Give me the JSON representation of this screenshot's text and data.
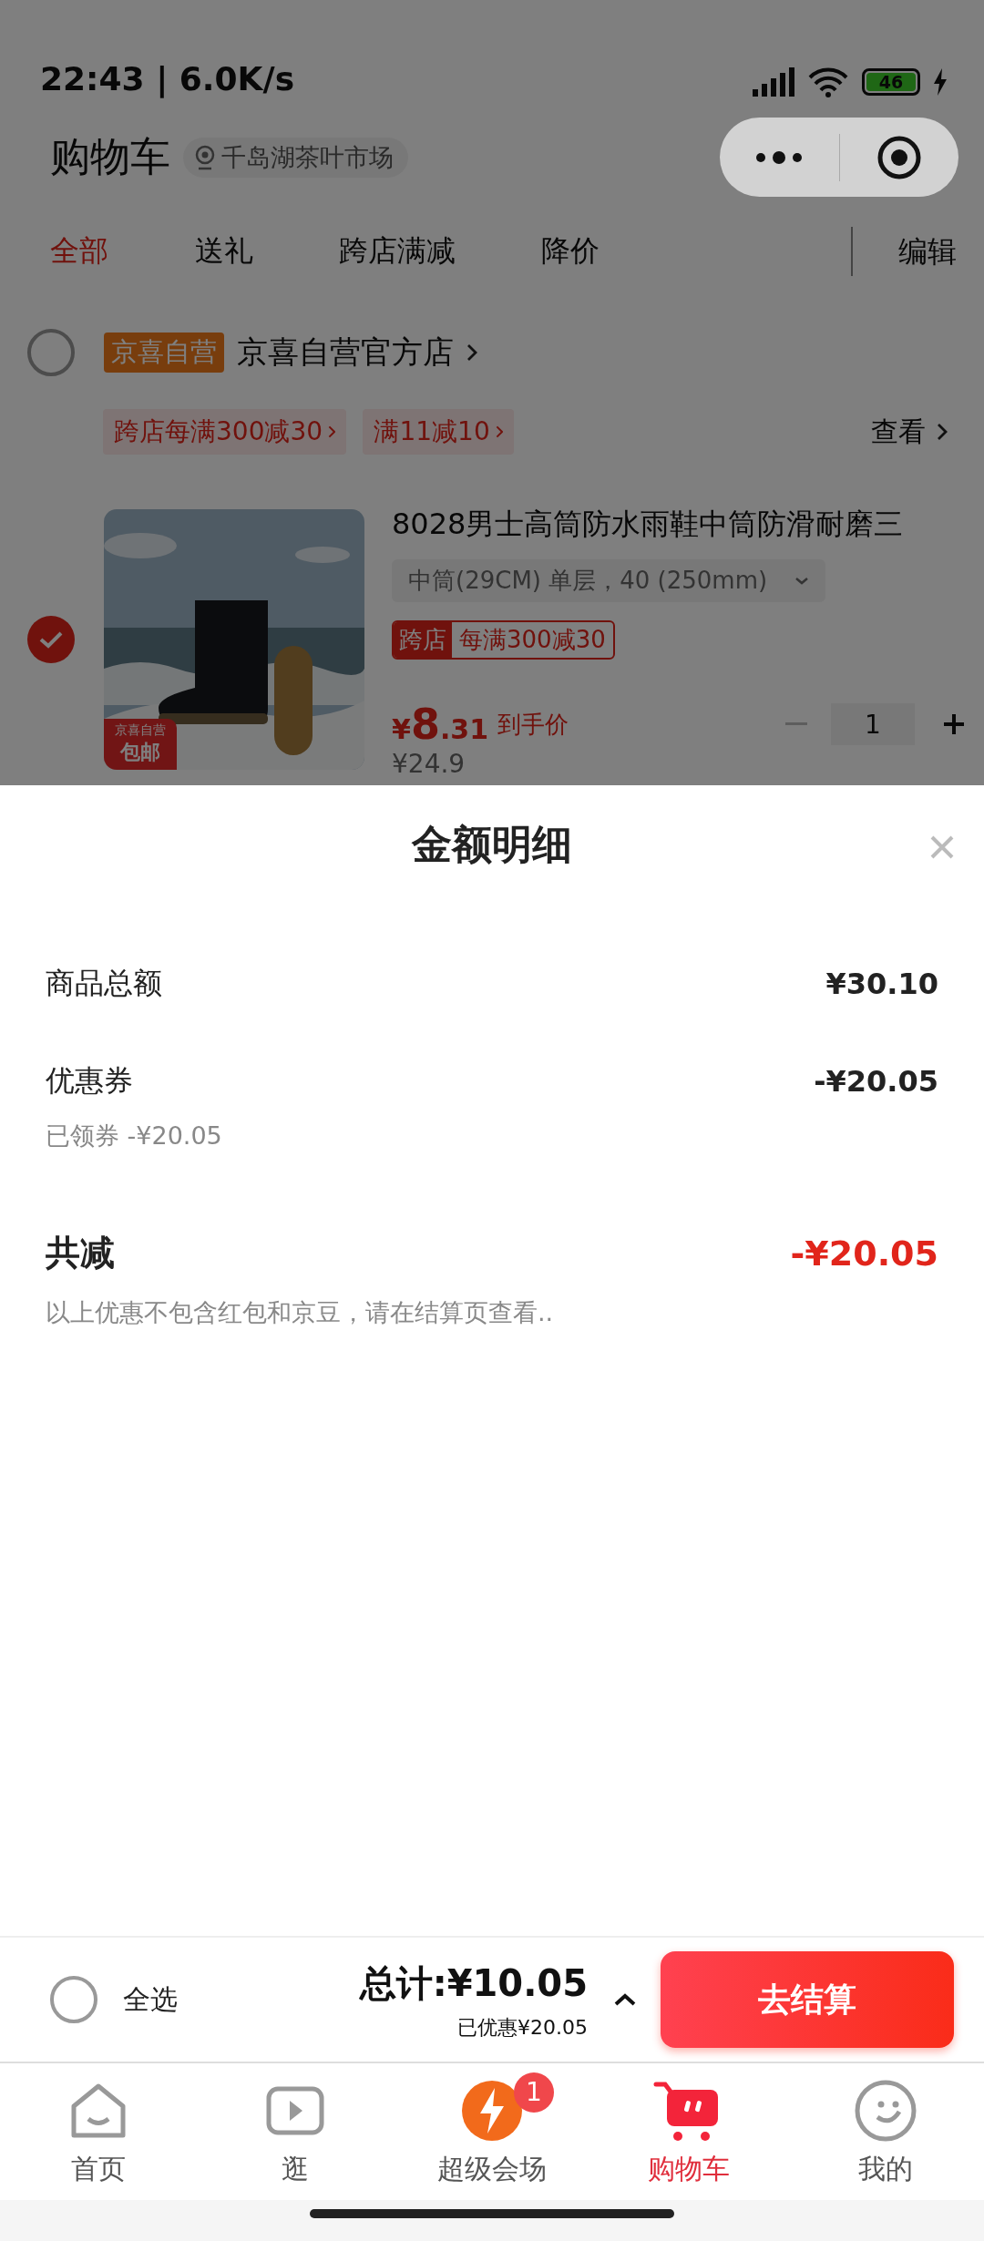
{
  "status_bar": {
    "time": "22:43 | 6.0K/s",
    "battery": "46",
    "charging": true
  },
  "header": {
    "title": "购物车",
    "location": "千岛湖茶叶市场"
  },
  "tabs": [
    {
      "label": "全部",
      "selected": true
    },
    {
      "label": "送礼",
      "selected": false
    },
    {
      "label": "跨店满减",
      "selected": false
    },
    {
      "label": "降价",
      "selected": false
    }
  ],
  "edit_button": "编辑",
  "store": {
    "checked": false,
    "badge": "京喜自营",
    "name": "京喜自营官方店",
    "promos": [
      "跨店每满300减30",
      "满11减10"
    ],
    "view_link": "查看"
  },
  "product": {
    "checked": true,
    "title": "8028男士高筒防水雨鞋中筒防滑耐磨三",
    "spec": "中筒(29CM) 单层，40 (250mm)",
    "tag_label": "跨店",
    "tag_text": "每满300减30",
    "image_badge_top": "京喜自营",
    "image_badge_bottom": "包邮",
    "price_symbol": "¥",
    "price_int": "8",
    "price_dec": ".31",
    "price_note": "到手价",
    "original_price": "¥24.9",
    "quantity": "1"
  },
  "sheet": {
    "title": "金额明细",
    "rows": [
      {
        "label": "商品总额",
        "value": "¥30.10"
      },
      {
        "label": "优惠券",
        "value": "-¥20.05",
        "note": "已领券 -¥20.05"
      }
    ],
    "total": {
      "label": "共减",
      "value": "-¥20.05"
    },
    "footnote": "以上优惠不包含红包和京豆，请在结算页查看.."
  },
  "checkout_bar": {
    "checked": false,
    "select_all": "全选",
    "total": "总计:¥10.05",
    "saved": "已优惠¥20.05",
    "button": "去结算"
  },
  "nav": [
    {
      "label": "首页",
      "kind": "home",
      "selected": false
    },
    {
      "label": "逛",
      "kind": "video",
      "selected": false
    },
    {
      "label": "超级会场",
      "kind": "deal",
      "selected": false,
      "badge": "1"
    },
    {
      "label": "购物车",
      "kind": "cart",
      "selected": true
    },
    {
      "label": "我的",
      "kind": "smile",
      "selected": false
    }
  ]
}
